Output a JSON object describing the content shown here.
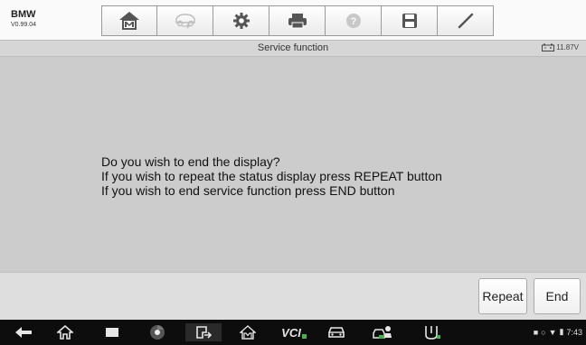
{
  "app": {
    "name": "BMW",
    "version": "V0.99.04"
  },
  "toolbar": {
    "icons": [
      "home-icon",
      "vehicle-swap-icon",
      "settings-icon",
      "print-icon",
      "help-icon",
      "save-icon",
      "pen-icon"
    ]
  },
  "titlebar": {
    "title": "Service function",
    "voltage": "11.87V"
  },
  "message": {
    "lines": [
      "Do you wish to end the display?",
      "If you wish to repeat the status display press REPEAT button",
      "If you wish to end service function press END button"
    ]
  },
  "actions": {
    "repeat_label": "Repeat",
    "end_label": "End"
  },
  "navbar": {
    "items": [
      "back-icon",
      "home-icon",
      "recent-apps-icon",
      "browser-icon",
      "switch-app-icon",
      "maxisys-home-icon",
      "vci-icon",
      "car-icon",
      "car-service-icon",
      "scanner-icon"
    ],
    "vci_label": "VCI",
    "time": "7:43"
  },
  "colors": {
    "message_bg": "#cccccc",
    "navbar_bg": "#0d0d0d",
    "vci_green": "#4caf50"
  }
}
